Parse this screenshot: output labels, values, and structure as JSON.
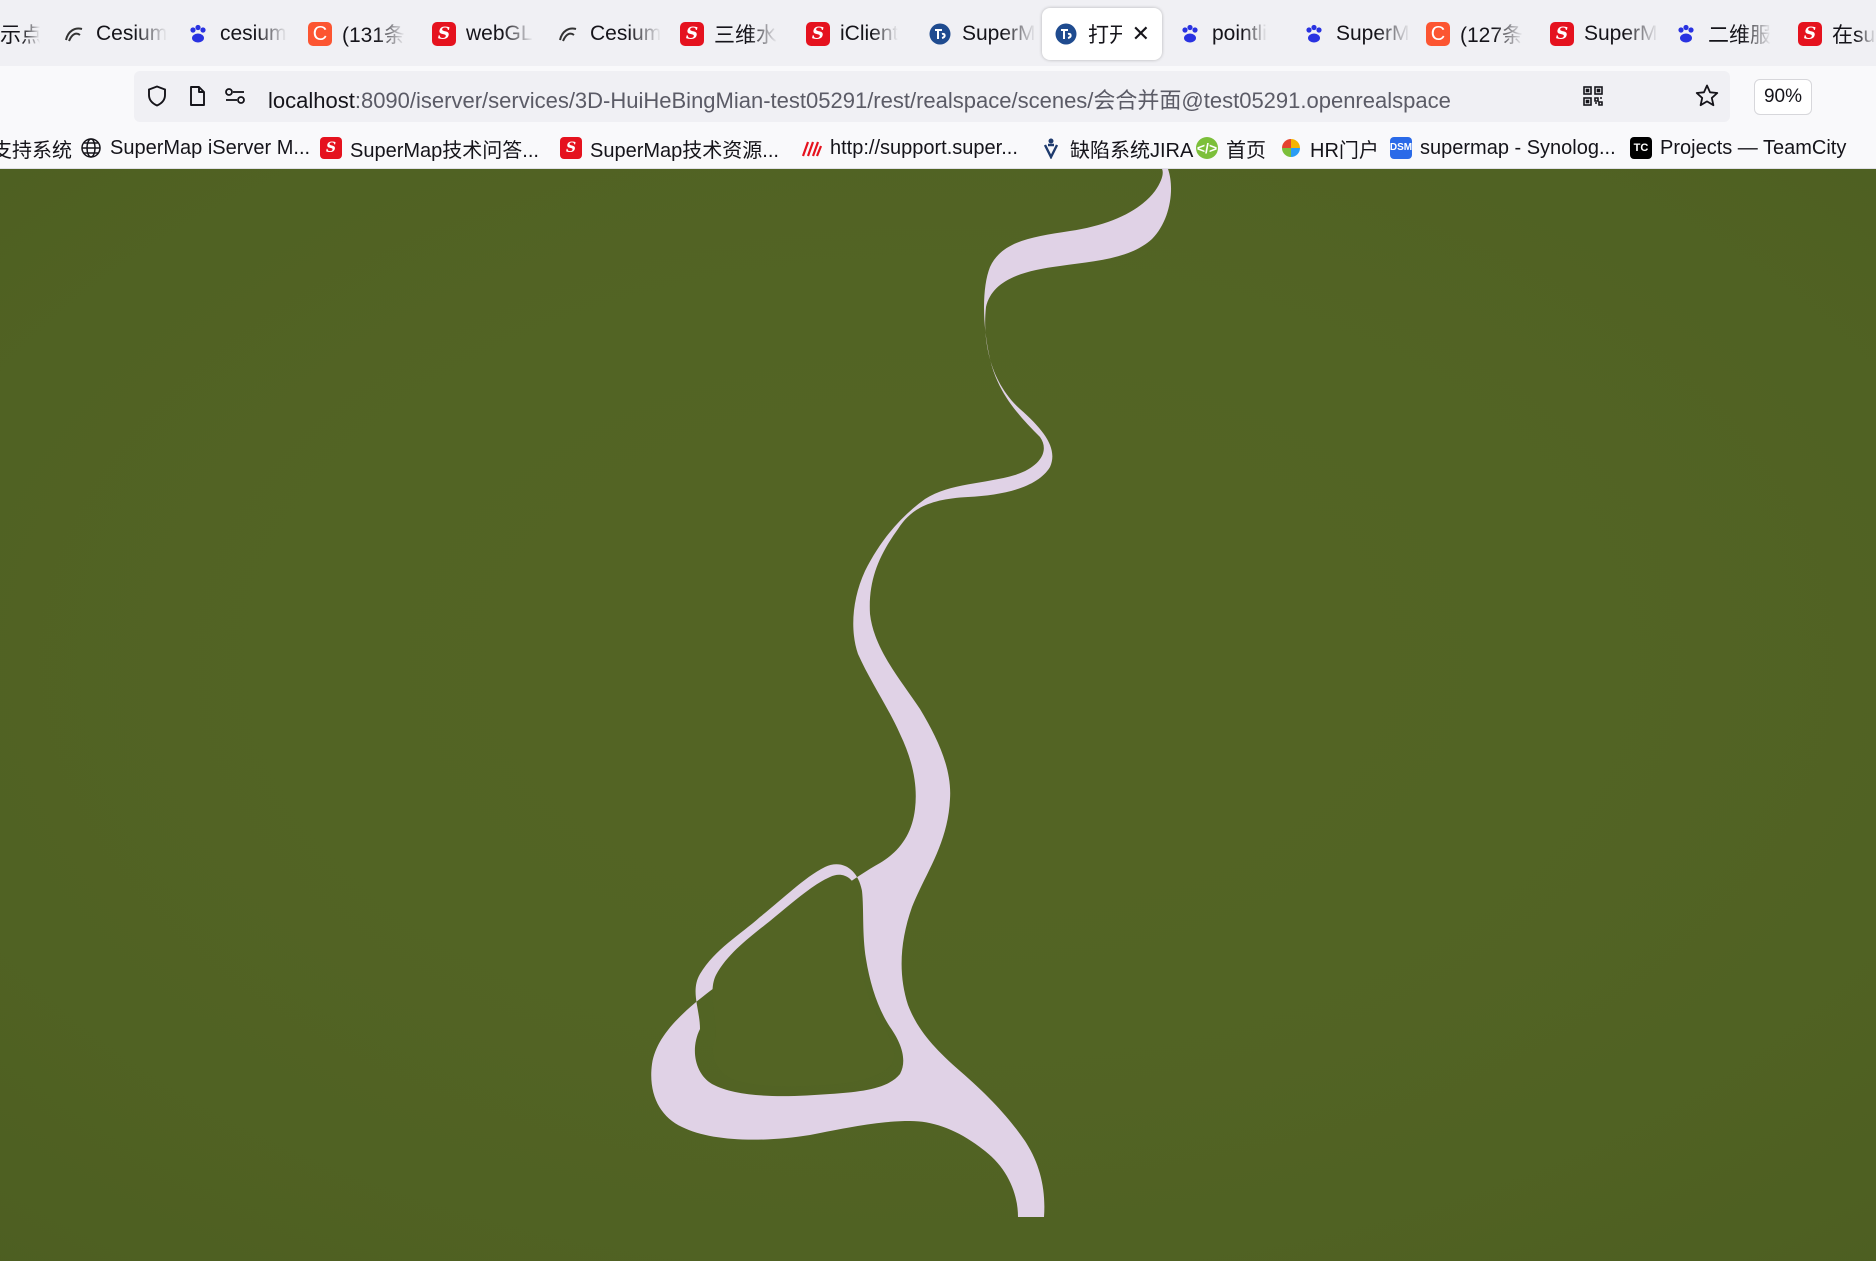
{
  "tabs": [
    {
      "label": "示点",
      "icon": "generic-page-icon"
    },
    {
      "label": "Cesium",
      "icon": "cesium-icon"
    },
    {
      "label": "cesium",
      "icon": "baidu-paw-icon"
    },
    {
      "label": "(131条",
      "icon": "csdn-c-icon"
    },
    {
      "label": "webGL",
      "icon": "supermap-s-icon"
    },
    {
      "label": "Cesium",
      "icon": "cesium-icon"
    },
    {
      "label": "三维水",
      "icon": "supermap-s-icon"
    },
    {
      "label": "iClient",
      "icon": "supermap-s-icon"
    },
    {
      "label": "SuperM",
      "icon": "supermap-globe-icon"
    },
    {
      "label": "打开",
      "icon": "supermap-globe-icon",
      "active": true
    },
    {
      "label": "pointli",
      "icon": "baidu-paw-icon"
    },
    {
      "label": "SuperM",
      "icon": "baidu-paw-icon"
    },
    {
      "label": "(127条",
      "icon": "csdn-c-icon"
    },
    {
      "label": "SuperM",
      "icon": "supermap-s-icon"
    },
    {
      "label": "二维服",
      "icon": "baidu-paw-icon"
    },
    {
      "label": "在sup",
      "icon": "supermap-s-icon"
    }
  ],
  "navbar": {
    "url_host": "localhost",
    "url_rest": ":8090/iserver/services/3D-HuiHeBingMian-test05291/rest/realspace/scenes/会合并面@test05291.openrealspace",
    "zoom": "90%",
    "icons": [
      "shield-icon",
      "page-icon",
      "permissions-icon",
      "qr-code-icon",
      "bookmark-star-icon"
    ]
  },
  "bookmarks": [
    {
      "label": "支持系统",
      "icon": "none"
    },
    {
      "label": "SuperMap iServer M...",
      "icon": "globe-icon"
    },
    {
      "label": "SuperMap技术问答...",
      "icon": "supermap-s-icon"
    },
    {
      "label": "SuperMap技术资源...",
      "icon": "supermap-s-icon"
    },
    {
      "label": "http://support.super...",
      "icon": "stripes-icon"
    },
    {
      "label": "缺陷系统JIRA",
      "icon": "jira-icon"
    },
    {
      "label": "首页",
      "icon": "code-circle-icon"
    },
    {
      "label": "HR门户",
      "icon": "pinwheel-icon"
    },
    {
      "label": "supermap - Synolog...",
      "icon": "dsm-icon"
    },
    {
      "label": "Projects — TeamCity",
      "icon": "teamcity-icon"
    }
  ],
  "scene": {
    "terrain_color": "#536424",
    "river_color": "#e0d2e6",
    "feature": "river-polygon"
  }
}
